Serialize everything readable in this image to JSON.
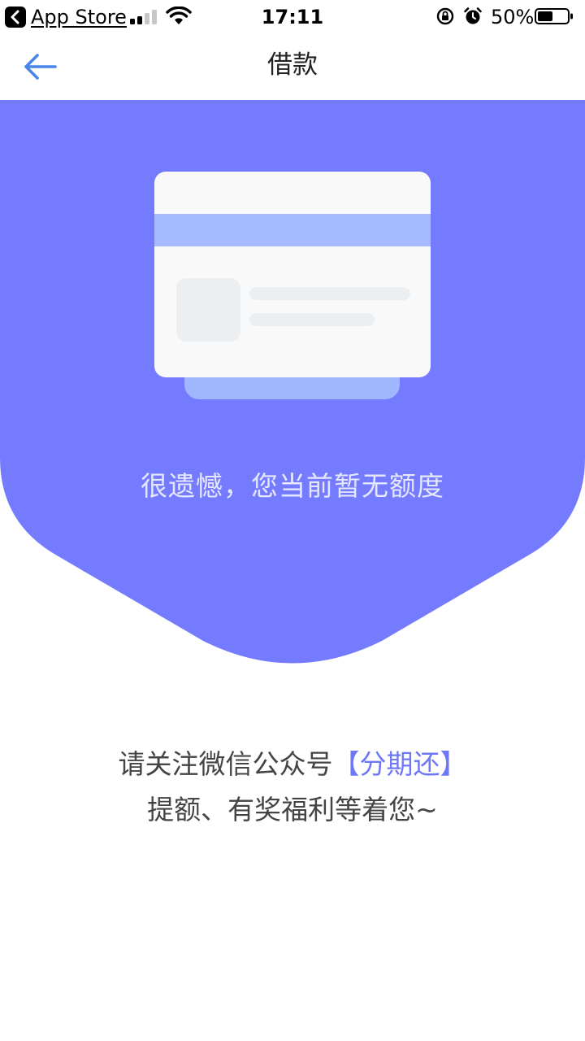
{
  "status_bar": {
    "back_app_label": "App Store",
    "time": "17:11",
    "battery_percent": "50%",
    "battery_level": 0.5,
    "signal_bars": 2,
    "icons": [
      "back-app-icon",
      "signal-icon",
      "wifi-icon",
      "orientation-lock-icon",
      "alarm-icon",
      "battery-icon"
    ]
  },
  "nav": {
    "title": "借款",
    "back_icon": "arrow-left-icon"
  },
  "hero": {
    "message": "很遗憾，您当前暂无额度",
    "illustration": "id-card-icon"
  },
  "follow": {
    "line1_prefix": "请关注微信公众号",
    "line1_highlight": "【分期还】",
    "line2": "提额、有奖福利等着您~"
  },
  "colors": {
    "accent": "#757bff",
    "link": "#6e77f6",
    "back_arrow": "#4a86e8",
    "card_stripe": "#a6baff"
  }
}
